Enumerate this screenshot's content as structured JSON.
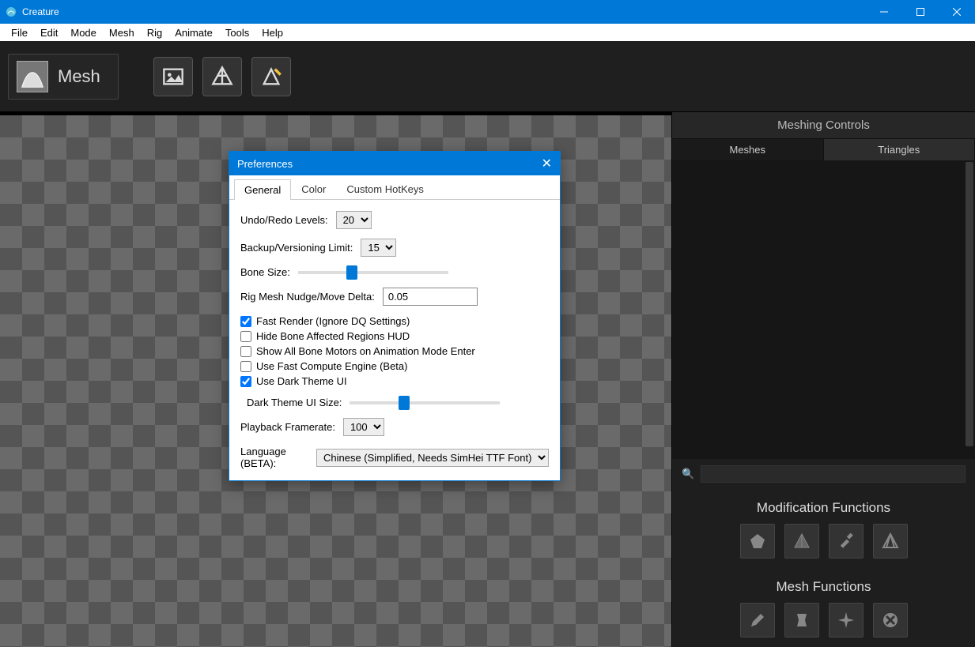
{
  "window": {
    "title": "Creature"
  },
  "menu": {
    "items": [
      "File",
      "Edit",
      "Mode",
      "Mesh",
      "Rig",
      "Animate",
      "Tools",
      "Help"
    ]
  },
  "toolbar": {
    "mode_label": "Mesh"
  },
  "rpanel": {
    "title": "Meshing Controls",
    "tabs": [
      "Meshes",
      "Triangles"
    ],
    "section1": "Modification Functions",
    "section2": "Mesh Functions"
  },
  "prefs": {
    "title": "Preferences",
    "tabs": [
      "General",
      "Color",
      "Custom HotKeys"
    ],
    "undo_label": "Undo/Redo Levels:",
    "undo_value": "20",
    "backup_label": "Backup/Versioning Limit:",
    "backup_value": "15",
    "bone_label": "Bone Size:",
    "rignudge_label": "Rig Mesh Nudge/Move Delta:",
    "rignudge_value": "0.05",
    "c1": "Fast Render (Ignore DQ Settings)",
    "c2": "Hide Bone Affected Regions HUD",
    "c3": "Show All Bone Motors on Animation Mode Enter",
    "c4": "Use Fast Compute Engine (Beta)",
    "c5": "Use Dark Theme UI",
    "darksize_label": "Dark Theme UI Size:",
    "playback_label": "Playback Framerate:",
    "playback_value": "100",
    "lang_label": "Language (BETA):",
    "lang_value": "Chinese (Simplified, Needs SimHei TTF Font)"
  }
}
